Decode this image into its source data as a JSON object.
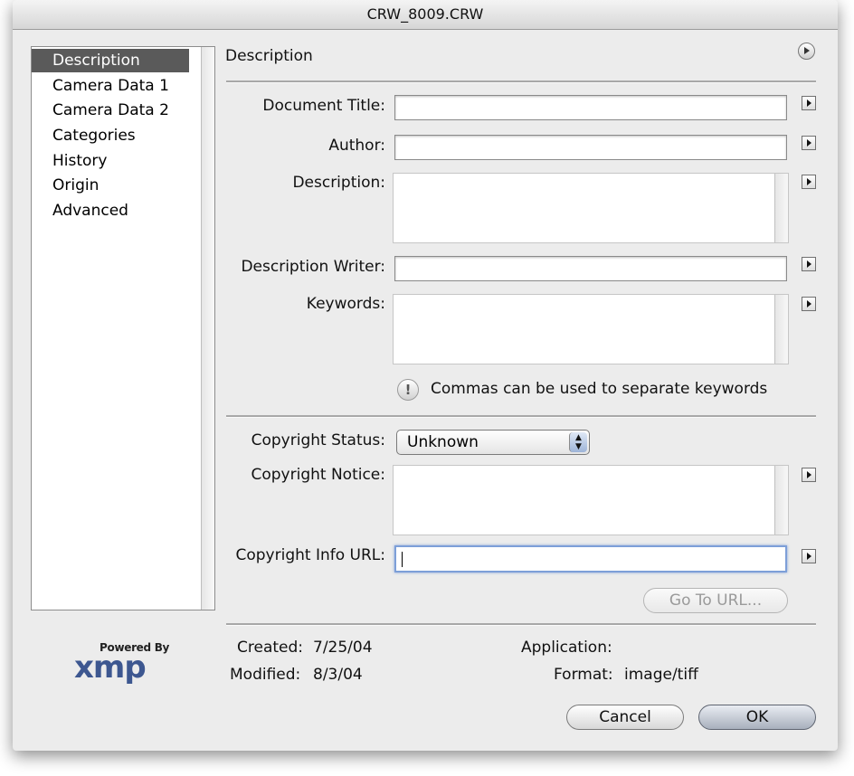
{
  "window": {
    "title": "CRW_8009.CRW"
  },
  "sidebar": {
    "items": [
      {
        "label": "Description",
        "selected": true
      },
      {
        "label": "Camera Data 1"
      },
      {
        "label": "Camera Data 2"
      },
      {
        "label": "Categories"
      },
      {
        "label": "History"
      },
      {
        "label": "Origin"
      },
      {
        "label": "Advanced"
      }
    ]
  },
  "panel": {
    "title": "Description",
    "fields": {
      "document_title": {
        "label": "Document Title:",
        "value": ""
      },
      "author": {
        "label": "Author:",
        "value": ""
      },
      "description": {
        "label": "Description:",
        "value": ""
      },
      "description_writer": {
        "label": "Description Writer:",
        "value": ""
      },
      "keywords": {
        "label": "Keywords:",
        "value": ""
      }
    },
    "keywords_hint": "Commas can be used to separate keywords",
    "copyright_status": {
      "label": "Copyright Status:",
      "value": "Unknown"
    },
    "copyright_notice": {
      "label": "Copyright Notice:",
      "value": ""
    },
    "copyright_url": {
      "label": "Copyright Info URL:",
      "value": ""
    },
    "go_to_url_label": "Go To URL..."
  },
  "footer": {
    "created_label": "Created:",
    "created_value": "7/25/04",
    "modified_label": "Modified:",
    "modified_value": "8/3/04",
    "application_label": "Application:",
    "application_value": "",
    "format_label": "Format:",
    "format_value": "image/tiff",
    "cancel_label": "Cancel",
    "ok_label": "OK"
  },
  "branding": {
    "powered_by": "Powered By",
    "logo_text": "xmp"
  },
  "colors": {
    "selection": "#5a5a5a",
    "focus_ring": "#7d9fd8",
    "xmp_logo": "#3d5790"
  }
}
